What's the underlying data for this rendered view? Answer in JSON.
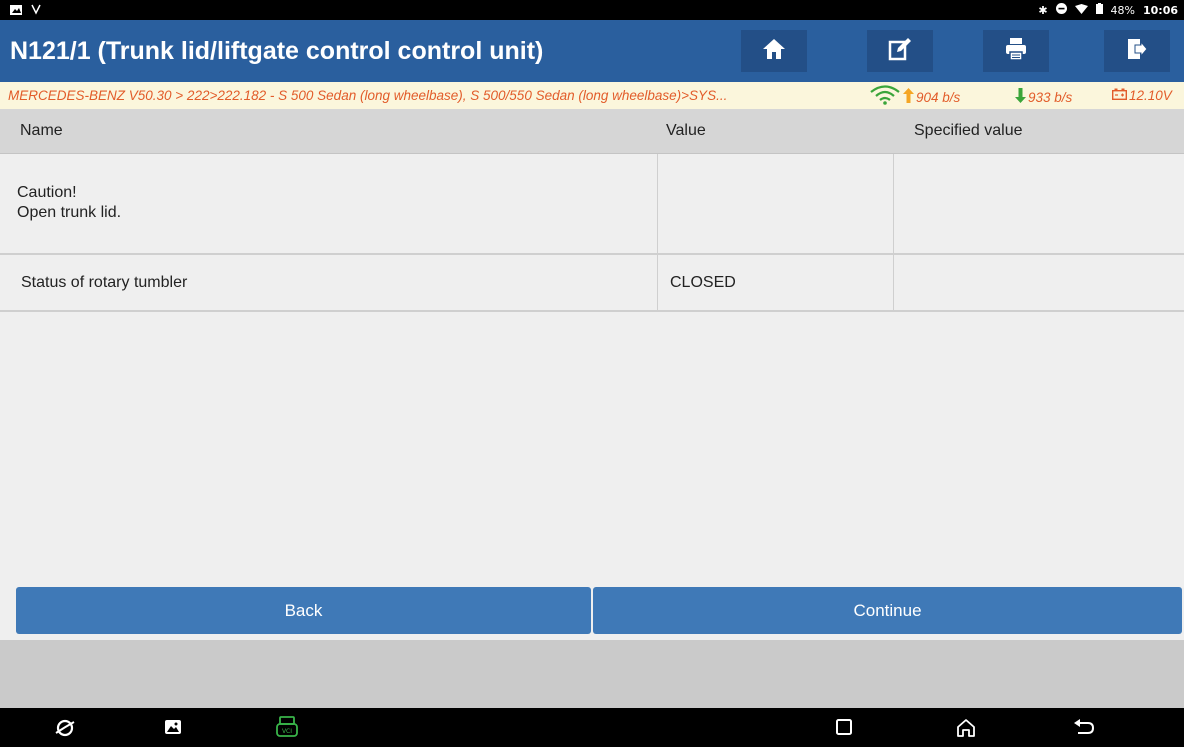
{
  "status_bar": {
    "battery": "48%",
    "time": "10:06"
  },
  "header": {
    "title": "N121/1 (Trunk lid/liftgate control control unit)",
    "buttons": [
      "home-icon",
      "edit-icon",
      "print-icon",
      "exit-icon"
    ]
  },
  "breadcrumb": {
    "path": "MERCEDES-BENZ V50.30 > 222>222.182 - S 500 Sedan (long wheelbase), S 500/550 Sedan (long wheelbase)>SYS...",
    "upload_speed": "904 b/s",
    "download_speed": "933 b/s",
    "voltage": "12.10V"
  },
  "table": {
    "headers": {
      "name": "Name",
      "value": "Value",
      "specified": "Specified value"
    },
    "rows": [
      {
        "name_line1": "Caution!",
        "name_line2": "Open trunk lid.",
        "value": "",
        "specified": ""
      },
      {
        "name": "Status of rotary tumbler",
        "value": "CLOSED",
        "specified": ""
      }
    ]
  },
  "actions": {
    "back_label": "Back",
    "continue_label": "Continue"
  },
  "colors": {
    "title_bg": "#2a5f9e",
    "button_bg": "#3f79b7",
    "breadcrumb_text": "#e25c2a",
    "speed_up": "#f5a623",
    "speed_down": "#3aa53a"
  }
}
